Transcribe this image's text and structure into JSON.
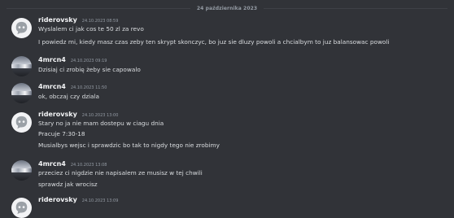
{
  "date_divider": "24 października 2023",
  "messages": [
    {
      "author": "riderovsky",
      "timestamp": "24.10.2023 08:59",
      "avatar": "discord-default-icon",
      "lines": [
        "Wyslalem ci jak cos te 50 zl za revo",
        "I powiedz mi, kiedy masz czas zeby ten skrypt skonczyc, bo juz sie dluzy powoli a chcialbym to juz balansowac powoli"
      ]
    },
    {
      "author": "4mrcn4",
      "timestamp": "24.10.2023 09:19",
      "avatar": "car-photo",
      "lines": [
        "Dzisiaj ci zrobię żeby sie capowalo"
      ]
    },
    {
      "author": "4mrcn4",
      "timestamp": "24.10.2023 11:50",
      "avatar": "car-photo",
      "lines": [
        "ok, obczaj czy dziala"
      ]
    },
    {
      "author": "riderovsky",
      "timestamp": "24.10.2023 13:00",
      "avatar": "discord-default-icon",
      "lines": [
        "Stary no ja nie mam dostepu w ciagu dnia",
        "Pracuje 7:30-18",
        "Musialbys wejsc i sprawdzic bo tak to nigdy tego nie zrobimy"
      ]
    },
    {
      "author": "4mrcn4",
      "timestamp": "24.10.2023 13:08",
      "avatar": "car-photo",
      "lines": [
        "przeciez ci nigdzie nie napisalem ze musisz w tej chwili",
        "sprawdz jak wrocisz"
      ]
    },
    {
      "author": "riderovsky",
      "timestamp": "24.10.2023 13:09",
      "avatar": "discord-default-icon",
      "lines": []
    }
  ]
}
